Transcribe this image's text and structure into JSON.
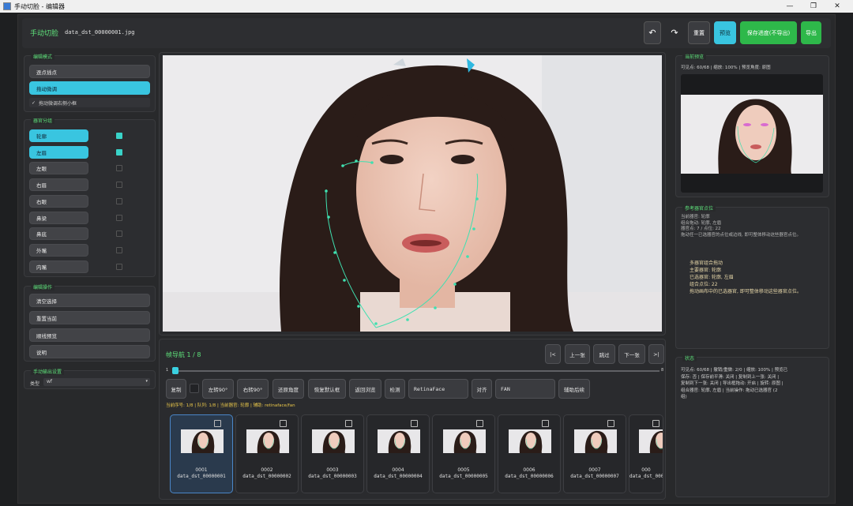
{
  "window": {
    "title": "手动切脸 - 编辑器",
    "minimize": "—",
    "restore": "❐",
    "close": "✕"
  },
  "header": {
    "brand": "手动切脸",
    "filename": "data_dst_00000001.jpg",
    "undo": "↶",
    "redo": "↷",
    "reset": "重置",
    "preview": "预览",
    "save_progress": "保存进度(不导出)",
    "export": "导出"
  },
  "edit_mode": {
    "title": "编辑模式",
    "point_insert": "逐点插点",
    "drag_adjust": "拖动微调",
    "drag_small_box": "拖动微调右侧小框",
    "check_mark": "✓"
  },
  "organ_group": {
    "title": "器官分组",
    "items": [
      {
        "label": "轮廓",
        "active": true
      },
      {
        "label": "左眉",
        "active": true
      },
      {
        "label": "左眼",
        "active": false
      },
      {
        "label": "右眉",
        "active": false
      },
      {
        "label": "右眼",
        "active": false
      },
      {
        "label": "鼻梁",
        "active": false
      },
      {
        "label": "鼻底",
        "active": false
      },
      {
        "label": "外嘴",
        "active": false
      },
      {
        "label": "内嘴",
        "active": false
      }
    ]
  },
  "edit_ops": {
    "title": "编辑操作",
    "clear": "清空选择",
    "reset_current": "重置当前",
    "link_preview": "顺线预览",
    "help": "说明"
  },
  "output": {
    "title": "手动输出设置",
    "type_label": "类型",
    "type_value": "wf"
  },
  "frame_nav": {
    "label": "帧导航 1 / 8",
    "first": "|<",
    "prev": "上一张",
    "skip": "跳过",
    "next": "下一张",
    "last": ">|",
    "slider_min": "1",
    "slider_max": "8",
    "progress": 0.0
  },
  "toolbar": {
    "copy": "复制",
    "rotate_left": "左转90°",
    "rotate_right": "右转90°",
    "restore_angle": "还原角度",
    "restore_default": "恢复默认框",
    "back_preview": "返回浏览",
    "detect": "检测",
    "detector": "RetinaFace",
    "align": "对齐",
    "aligner": "FAN",
    "assist": "辅助后续"
  },
  "status_line": "当前序号: 1/8 | 队列: 1/8 | 当前器官: 轮廓 | 辅助: retinaface/fan",
  "thumbnails": [
    {
      "num": "0001",
      "file": "data_dst_00000001",
      "selected": true
    },
    {
      "num": "0002",
      "file": "data_dst_00000002",
      "selected": false
    },
    {
      "num": "0003",
      "file": "data_dst_00000003",
      "selected": false
    },
    {
      "num": "0004",
      "file": "data_dst_00000004",
      "selected": false
    },
    {
      "num": "0005",
      "file": "data_dst_00000005",
      "selected": false
    },
    {
      "num": "0006",
      "file": "data_dst_00000006",
      "selected": false
    },
    {
      "num": "0007",
      "file": "data_dst_00000007",
      "selected": false
    },
    {
      "num": "000",
      "file": "data_dst_0000",
      "selected": false
    }
  ],
  "current_preview": {
    "title": "当前预览",
    "info": "可见点: 60/68 | 缩放: 100% | 预览角度: 原图"
  },
  "reference": {
    "title": "参考器官点位",
    "lines": [
      "当前器官: 轮廓",
      "组合拖动: 轮廓, 左眉",
      "器官点: 7 / 点位: 22",
      "拖动任一已选器官的点位或边线, 即可整体移动这些器官点位。"
    ],
    "lines2": [
      "多器官组合拖动",
      "主要器官: 轮廓",
      "已选器官: 轮廓, 左眉",
      "组合点位: 22",
      "拖动画布中的已选器官, 即可整体移动这些器官点位。"
    ]
  },
  "status": {
    "title": "状态",
    "lines": [
      "可见点: 60/68 | 撤销/重做: 2/0 | 缩放: 100% | 预览已",
      "保存: 否 | 保存前平滑: 关闭 | 复制到上一张: 关闭 |",
      "复制到下一张: 关闭 | 导出框拖动: 开启 | 旋转: 原图 |",
      "组合器官: 轮廓, 左眉 | 当前操作: 拖动已选器官 (2",
      "组)"
    ]
  },
  "colors": {
    "accent": "#39c5e0",
    "green": "#5ee07a",
    "primary_green": "#2eb84a",
    "landmark": "#3fe0b0"
  }
}
